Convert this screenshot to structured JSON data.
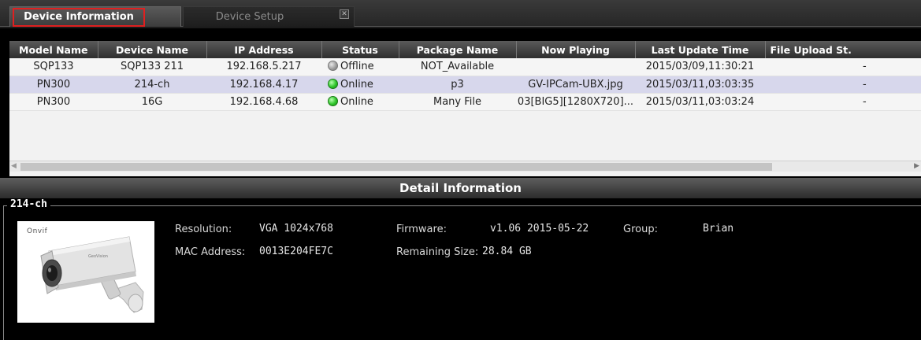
{
  "tabs": {
    "device_information": "Device Information",
    "device_setup": "Device Setup",
    "close_glyph": "✕"
  },
  "table": {
    "columns": [
      "Model Name",
      "Device Name",
      "IP Address",
      "Status",
      "Package Name",
      "Now Playing",
      "Last Update Time",
      "File Upload St."
    ],
    "rows": [
      {
        "model": "SQP133",
        "device": "SQP133 211",
        "ip": "192.168.5.217",
        "status": "Offline",
        "package": "NOT_Available",
        "playing": "",
        "updated": "2015/03/09,11:30:21",
        "upload": "-"
      },
      {
        "model": "PN300",
        "device": "214-ch",
        "ip": "192.168.4.17",
        "status": "Online",
        "package": "p3",
        "playing": "GV-IPCam-UBX.jpg",
        "updated": "2015/03/11,03:03:35",
        "upload": "-"
      },
      {
        "model": "PN300",
        "device": "16G",
        "ip": "192.168.4.68",
        "status": "Online",
        "package": "Many File",
        "playing": "03[BIG5][1280X720]...",
        "updated": "2015/03/11,03:03:24",
        "upload": "-"
      }
    ],
    "selected_row": 1
  },
  "detail": {
    "header": "Detail Information",
    "device_name": "214-ch",
    "brand_mark": "Onvif",
    "resolution_label": "Resolution:",
    "resolution_value": "VGA 1024x768",
    "mac_label": "MAC Address:",
    "mac_value": "0013E204FE7C",
    "firmware_label": "Firmware:",
    "firmware_value": "v1.06 2015-05-22",
    "remaining_label": "Remaining Size:",
    "remaining_value": "28.84 GB",
    "group_label": "Group:",
    "group_value": "Brian"
  },
  "colors": {
    "online": "#2fc52a",
    "offline": "#999999",
    "selected_row": "#d7d7ec",
    "tab_highlight": "#e02020"
  },
  "icons": {
    "online_status": "green-dot-icon",
    "offline_status": "gray-dot-icon",
    "close": "close-icon",
    "scroll_left": "arrow-left-icon",
    "scroll_right": "arrow-right-icon"
  }
}
